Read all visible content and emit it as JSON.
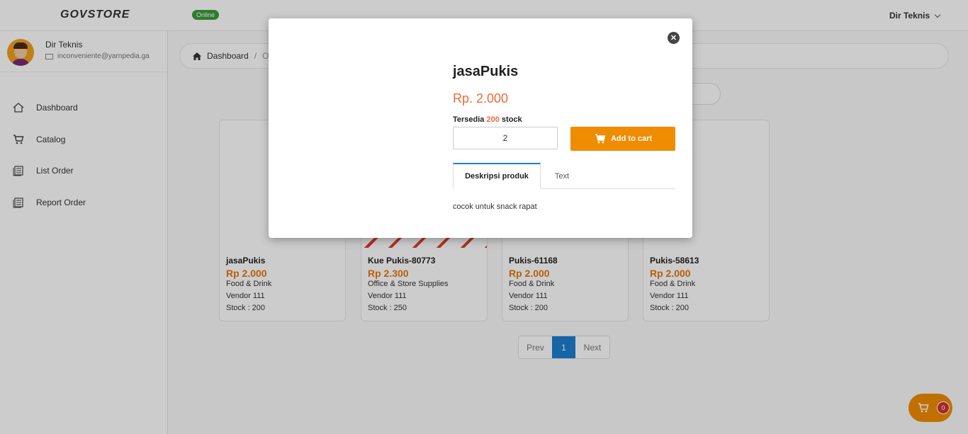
{
  "header": {
    "logo": "GOVSTORE",
    "status_badge": "Online",
    "user_menu": "Dir Teknis"
  },
  "sidebar": {
    "profile": {
      "name": "Dir Teknis",
      "email": "inconveniente@yarnpedia.ga"
    },
    "items": [
      {
        "label": "Dashboard",
        "icon": "home-icon"
      },
      {
        "label": "Catalog",
        "icon": "cart-icon"
      },
      {
        "label": "List Order",
        "icon": "list-icon"
      },
      {
        "label": "Report Order",
        "icon": "report-icon"
      }
    ]
  },
  "breadcrumb": {
    "home": "Dashboard",
    "separator": "/",
    "current": "O"
  },
  "products": [
    {
      "title": "jasaPukis",
      "price": "Rp 2.000",
      "category": "Food & Drink",
      "vendor": "Vendor 111",
      "stock": "Stock : 200"
    },
    {
      "title": "Kue Pukis-80773",
      "price": "Rp 2.300",
      "category": "Office & Store Supplies",
      "vendor": "Vendor 111",
      "stock": "Stock : 250"
    },
    {
      "title": "Pukis-61168",
      "price": "Rp 2.000",
      "category": "Food & Drink",
      "vendor": "Vendor 111",
      "stock": "Stock : 200"
    },
    {
      "title": "Pukis-58613",
      "price": "Rp 2.000",
      "category": "Food & Drink",
      "vendor": "Vendor 111",
      "stock": "Stock : 200"
    }
  ],
  "pagination": {
    "prev": "Prev",
    "current": "1",
    "next": "Next"
  },
  "cart": {
    "count": "0"
  },
  "modal": {
    "title": "jasaPukis",
    "price": "Rp. 2.000",
    "stock_prefix": "Tersedia",
    "stock_qty": "200",
    "stock_suffix": "stock",
    "quantity": "2",
    "add_to_cart": "Add to cart",
    "tabs": [
      "Deskripsi produk",
      "Text"
    ],
    "description": "cocok untuk snack rapat"
  },
  "colors": {
    "accent": "#f08c00",
    "price": "#e8760a",
    "primary": "#1b7fd1",
    "online": "#3a9c3a"
  }
}
